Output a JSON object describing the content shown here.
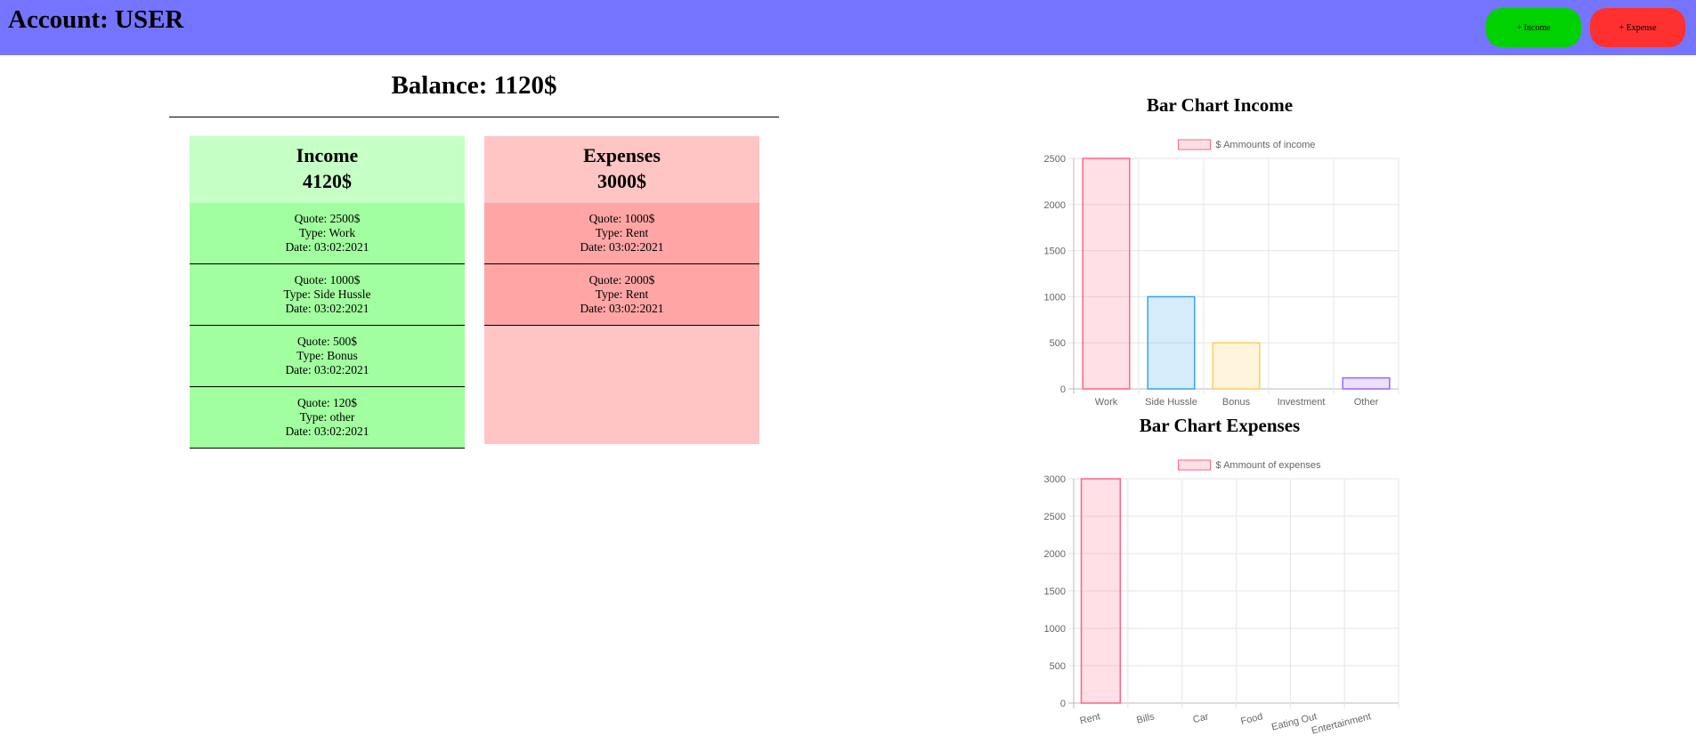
{
  "header": {
    "title": "Account: USER",
    "income_button": "+ Income",
    "expense_button": "+ Expense"
  },
  "balance_text": "Balance: 1120$",
  "income_panel": {
    "title": "Income",
    "total": "4120$",
    "entries": [
      {
        "quote": "Quote: 2500$",
        "type": "Type: Work",
        "date": "Date: 03:02:2021"
      },
      {
        "quote": "Quote: 1000$",
        "type": "Type: Side Hussle",
        "date": "Date: 03:02:2021"
      },
      {
        "quote": "Quote: 500$",
        "type": "Type: Bonus",
        "date": "Date: 03:02:2021"
      },
      {
        "quote": "Quote: 120$",
        "type": "Type: other",
        "date": "Date: 03:02:2021"
      }
    ]
  },
  "expense_panel": {
    "title": "Expenses",
    "total": "3000$",
    "entries": [
      {
        "quote": "Quote: 1000$",
        "type": "Type: Rent",
        "date": "Date: 03:02:2021"
      },
      {
        "quote": "Quote: 2000$",
        "type": "Type: Rent",
        "date": "Date: 03:02:2021"
      }
    ]
  },
  "colors": {
    "topbar": "#7474ff",
    "income_button": "#00d100",
    "expense_button": "#ff3030",
    "income_panel": "#c5ffc5",
    "income_entry": "#a2ff9f",
    "expense_panel": "#ffc5c5",
    "expense_entry": "#ffa5a5"
  },
  "chart_data": [
    {
      "type": "bar",
      "title": "Bar Chart Income",
      "legend": "$ Ammounts of income",
      "categories": [
        "Work",
        "Side Hussle",
        "Bonus",
        "Investment",
        "Other"
      ],
      "values": [
        2500,
        1000,
        500,
        0,
        120
      ],
      "yticks": [
        0,
        500,
        1000,
        1500,
        2000,
        2500
      ],
      "ylim": [
        0,
        2500
      ],
      "grid": true,
      "legend_position": "top",
      "fills": [
        "rgba(255,99,132,0.2)",
        "rgba(54,162,235,0.2)",
        "rgba(255,206,86,0.2)",
        "rgba(75,192,192,0.2)",
        "rgba(153,102,255,0.2)"
      ],
      "strokes": [
        "rgba(255,99,132,1)",
        "rgba(54,162,235,1)",
        "rgba(255,206,86,1)",
        "rgba(75,192,192,1)",
        "rgba(153,102,255,1)"
      ]
    },
    {
      "type": "bar",
      "title": "Bar Chart Expenses",
      "legend": "$ Ammount of expenses",
      "categories": [
        "Rent",
        "Bills",
        "Car",
        "Food",
        "Eating Out",
        "Entertainment"
      ],
      "values": [
        3000,
        0,
        0,
        0,
        0,
        0
      ],
      "yticks": [
        0,
        500,
        1000,
        1500,
        2000,
        2500,
        3000
      ],
      "ylim": [
        0,
        3000
      ],
      "grid": true,
      "legend_position": "top",
      "fills": [
        "rgba(255,99,132,0.2)",
        "rgba(54,162,235,0.2)",
        "rgba(255,206,86,0.2)",
        "rgba(75,192,192,0.2)",
        "rgba(153,102,255,0.2)",
        "rgba(255,159,64,0.2)"
      ],
      "strokes": [
        "rgba(255,99,132,1)",
        "rgba(54,162,235,1)",
        "rgba(255,206,86,1)",
        "rgba(75,192,192,1)",
        "rgba(153,102,255,1)",
        "rgba(255,159,64,1)"
      ]
    }
  ]
}
